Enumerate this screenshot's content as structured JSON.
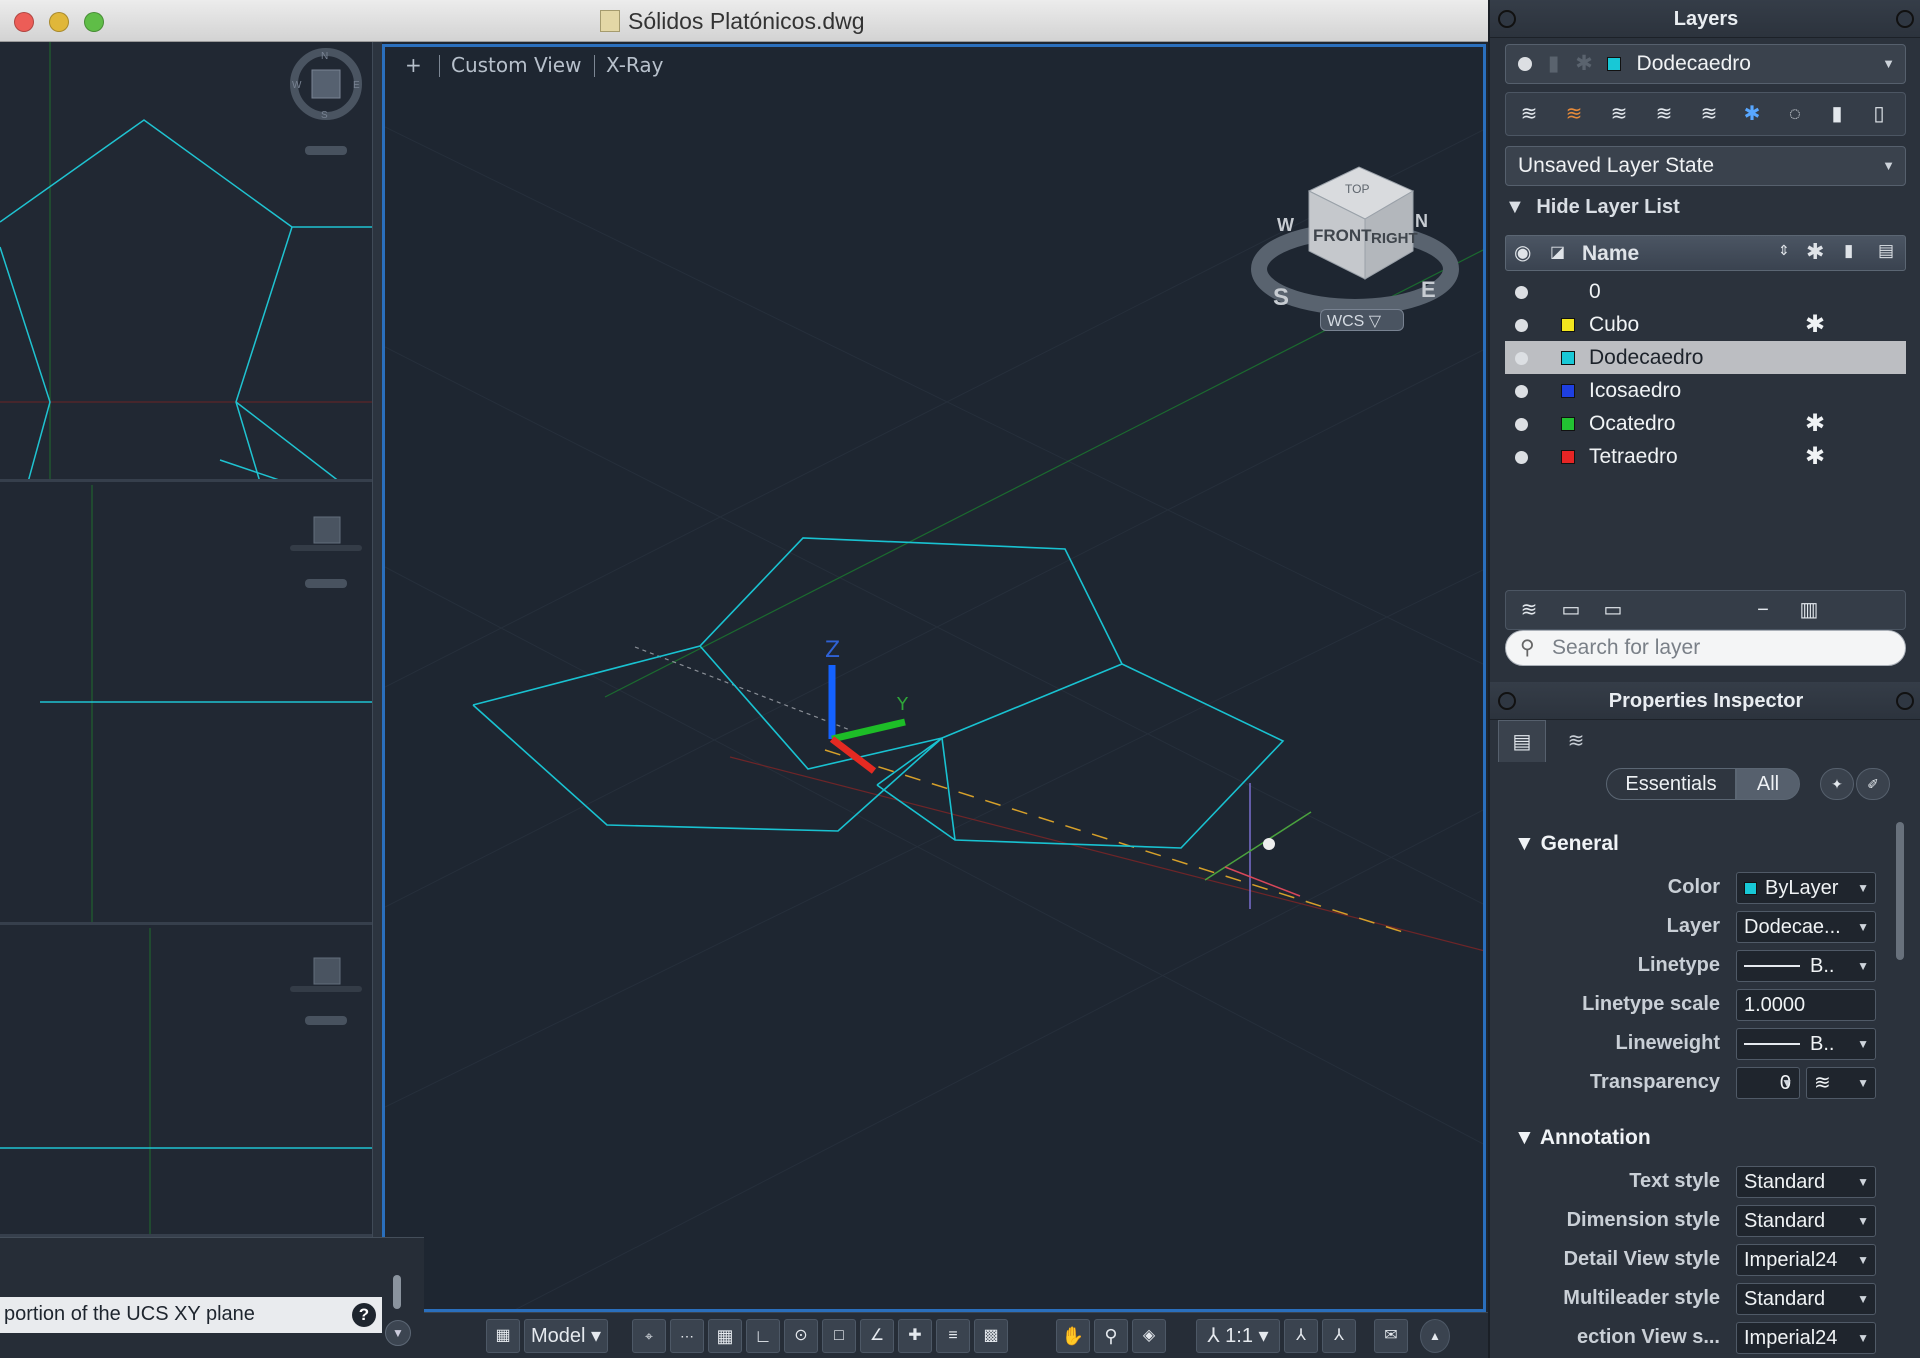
{
  "window": {
    "title": "Sólidos Platónicos.dwg"
  },
  "viewport": {
    "add_label": "+",
    "view_label": "Custom View",
    "style_label": "X-Ray",
    "wcs_label": "WCS"
  },
  "viewcube": {
    "top": "TOP",
    "front": "FRONT",
    "right": "RIGHT",
    "n": "N",
    "s": "S",
    "e": "E",
    "w": "W"
  },
  "axes": {
    "z": "Z",
    "y": "Y"
  },
  "command": {
    "prompt_text": "portion of the UCS XY plane",
    "help": "?"
  },
  "statusbar": {
    "model": "Model",
    "scale": "1:1"
  },
  "layers_panel": {
    "title": "Layers",
    "current_layer": "Dodecaedro",
    "current_color": "#18c8d6",
    "layer_state": "Unsaved Layer State",
    "hide_list": "Hide Layer List",
    "name_header": "Name",
    "search_placeholder": "Search for layer",
    "layers": [
      {
        "name": "0",
        "color": "",
        "frozen": false,
        "selected": false
      },
      {
        "name": "Cubo",
        "color": "#f2e51e",
        "frozen": true,
        "selected": false
      },
      {
        "name": "Dodecaedro",
        "color": "#18c8d6",
        "frozen": false,
        "selected": true
      },
      {
        "name": "Icosaedro",
        "color": "#1e3fe0",
        "frozen": false,
        "selected": false
      },
      {
        "name": "Ocatedro",
        "color": "#22c232",
        "frozen": true,
        "selected": false
      },
      {
        "name": "Tetraedro",
        "color": "#e62525",
        "frozen": true,
        "selected": false
      }
    ]
  },
  "properties": {
    "title": "Properties Inspector",
    "essentials": "Essentials",
    "all": "All",
    "general_section": "General",
    "annotation_section": "Annotation",
    "general": [
      {
        "label": "Color",
        "value": "ByLayer"
      },
      {
        "label": "Layer",
        "value": "Dodecae..."
      },
      {
        "label": "Linetype",
        "value": "B.."
      },
      {
        "label": "Linetype scale",
        "value": "1.0000"
      },
      {
        "label": "Lineweight",
        "value": "B.."
      },
      {
        "label": "Transparency",
        "value": "0"
      }
    ],
    "annotation": [
      {
        "label": "Text style",
        "value": "Standard"
      },
      {
        "label": "Dimension style",
        "value": "Standard"
      },
      {
        "label": "Detail View style",
        "value": "Imperial24"
      },
      {
        "label": "Multileader style",
        "value": "Standard"
      },
      {
        "label": "ection View s...",
        "value": "Imperial24"
      }
    ]
  },
  "colors": {
    "cyan": "#18c8d6",
    "accent": "#2a6fbd"
  }
}
